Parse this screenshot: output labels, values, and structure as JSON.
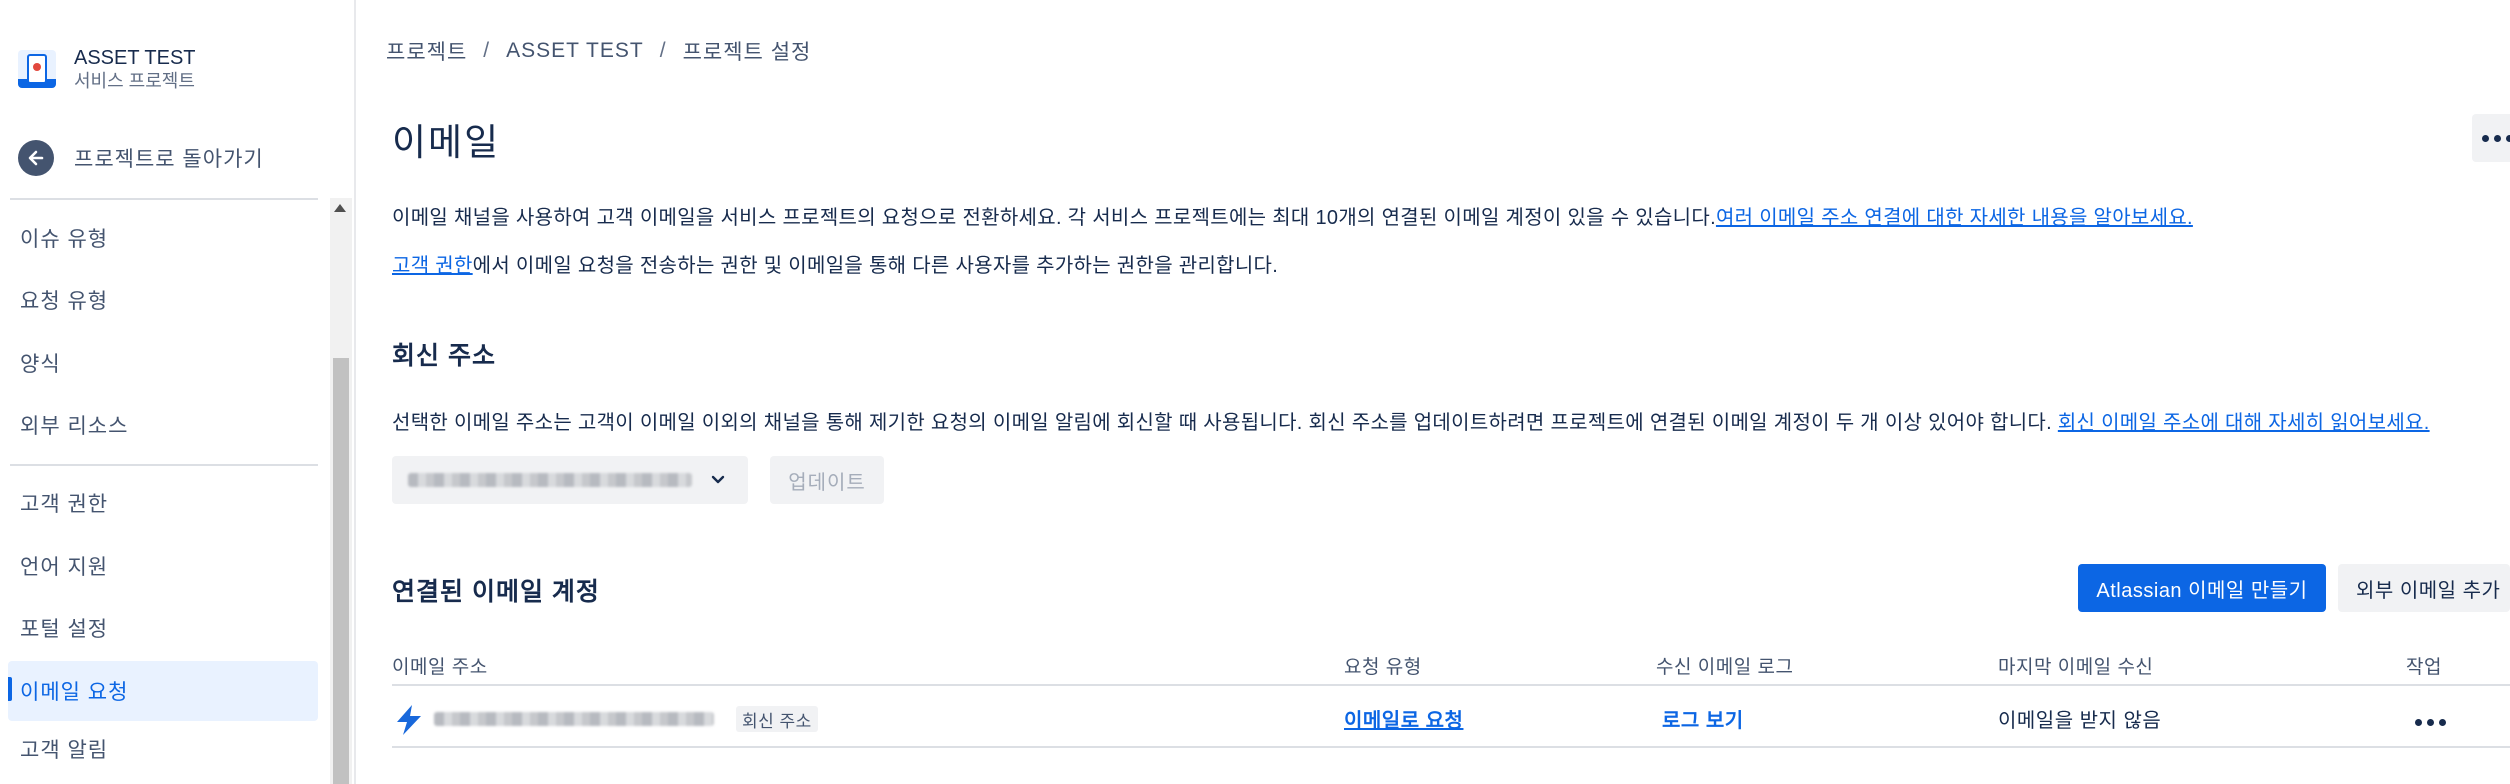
{
  "project": {
    "name": "ASSET TEST",
    "type": "서비스 프로젝트"
  },
  "sidebar": {
    "back_label": "프로젝트로 돌아가기",
    "group1": [
      {
        "label": "이슈 유형"
      },
      {
        "label": "요청 유형"
      },
      {
        "label": "양식"
      },
      {
        "label": "외부 리소스"
      }
    ],
    "group2": [
      {
        "label": "고객 권한"
      },
      {
        "label": "언어 지원"
      },
      {
        "label": "포털 설정"
      },
      {
        "label": "이메일 요청",
        "active": true
      },
      {
        "label": "고객 알림"
      }
    ]
  },
  "breadcrumb": [
    "프로젝트",
    "ASSET TEST",
    "프로젝트 설정"
  ],
  "breadcrumb_sep": "/",
  "page": {
    "title": "이메일",
    "intro_text": "이메일 채널을 사용하여 고객 이메일을 서비스 프로젝트의 요청으로 전환하세요. 각 서비스 프로젝트에는 최대 10개의 연결된 이메일 계정이 있을 수 있습니다.",
    "intro_link": "여러 이메일 주소 연결에 대한 자세한 내용을 알아보세요.",
    "perm_link": "고객 권한",
    "perm_text": "에서 이메일 요청을 전송하는 권한 및 이메일을 통해 다른 사용자를 추가하는 권한을 관리합니다."
  },
  "reply": {
    "title": "회신 주소",
    "desc": "선택한 이메일 주소는 고객이 이메일 이외의 채널을 통해 제기한 요청의 이메일 알림에 회신할 때 사용됩니다. 회신 주소를 업데이트하려면 프로젝트에 연결된 이메일 계정이 두 개 이상 있어야 합니다. ",
    "desc_link": "회신 이메일 주소에 대해 자세히 읽어보세요.",
    "update_label": "업데이트"
  },
  "accounts": {
    "title": "연결된 이메일 계정",
    "create_button": "Atlassian 이메일 만들기",
    "external_button": "외부 이메일 추가",
    "columns": {
      "email": "이메일 주소",
      "request_type": "요청 유형",
      "log": "수신 이메일 로그",
      "last_received": "마지막 이메일 수신",
      "actions": "작업"
    },
    "rows": [
      {
        "badge": "회신 주소",
        "request_type": "이메일로 요청",
        "log": "로그 보기",
        "last_received": "이메일을 받지 않음"
      }
    ]
  },
  "colors": {
    "primary": "#0c66e4",
    "text": "#172b4d",
    "subtle": "#44546f",
    "active_bg": "#e9f2ff"
  }
}
